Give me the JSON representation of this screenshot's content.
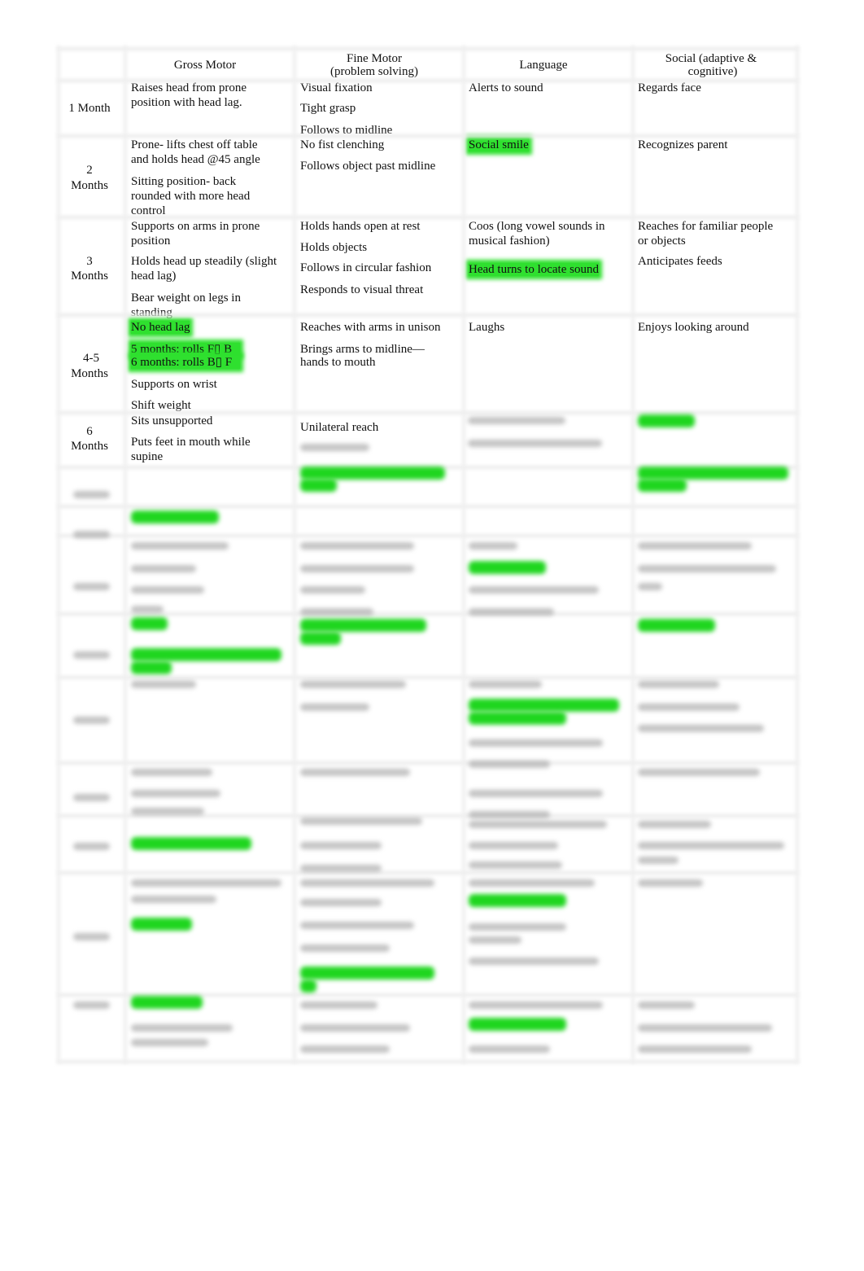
{
  "table": {
    "headers": [
      "",
      "Gross Motor",
      "Fine Motor\n(problem solving)",
      "Language",
      "Social (adaptive &\ncognitive)"
    ],
    "header_lines": {
      "gross": "Gross Motor",
      "fine_1": "Fine Motor",
      "fine_2": "(problem solving)",
      "language": "Language",
      "social_1": "Social (adaptive &",
      "social_2": "cognitive)"
    },
    "rows": [
      {
        "age": [
          "1 Month"
        ],
        "gross": [
          "Raises head from prone",
          "position with head lag."
        ],
        "fine": [
          "Visual fixation",
          "Tight grasp",
          "Follows to midline"
        ],
        "language": [
          "Alerts to sound"
        ],
        "social": [
          "Regards face"
        ]
      },
      {
        "age": [
          "2",
          "Months"
        ],
        "gross": [
          "Prone- lifts chest off table",
          "and holds head @45 angle",
          "Sitting position- back",
          "rounded with more head",
          "control"
        ],
        "fine": [
          "No fist clenching",
          "Follows object past midline"
        ],
        "language": [
          "Social smile"
        ],
        "social": [
          "Recognizes parent"
        ]
      },
      {
        "age": [
          "3",
          "Months"
        ],
        "gross": [
          "Supports on arms in prone",
          "position",
          "Holds head up steadily (slight",
          "head lag)",
          "Bear weight on legs in",
          "standing"
        ],
        "fine": [
          "Holds hands open at rest",
          "Holds objects",
          "Follows in circular fashion",
          "Responds to visual threat"
        ],
        "language": [
          "Coos (long vowel sounds in",
          "musical fashion)",
          "Head turns to locate sound"
        ],
        "social": [
          "Reaches for familiar people",
          "or objects",
          "Anticipates feeds"
        ]
      },
      {
        "age": [
          "4-5",
          "Months"
        ],
        "gross": [
          "No head lag",
          "5 months: rolls F▯   B",
          "6 months: rolls B▯   F",
          "Supports on wrist",
          "Shift weight"
        ],
        "fine": [
          "Reaches with arms in unison",
          "Brings arms to midline—",
          "hands to mouth"
        ],
        "language": [
          "Laughs"
        ],
        "social": [
          "Enjoys looking around"
        ]
      },
      {
        "age": [
          "6",
          "Months"
        ],
        "gross": [
          "Sits unsupported",
          "Puts feet in mouth while",
          "supine"
        ],
        "fine": [
          "Unilateral reach"
        ],
        "language": [],
        "social": []
      }
    ]
  },
  "colors": {
    "highlight": "#2fe02f",
    "grid": "#ececec",
    "text": "#111111"
  }
}
